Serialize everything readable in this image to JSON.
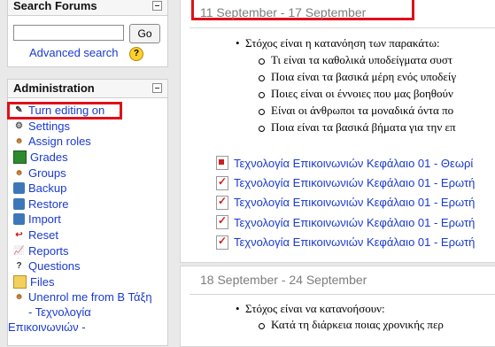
{
  "search_block": {
    "title": "Search Forums",
    "input_value": "",
    "go_label": "Go",
    "advanced_label": "Advanced search",
    "help_glyph": "?"
  },
  "admin_block": {
    "title": "Administration",
    "items": [
      {
        "label": "Turn editing on",
        "icon": "edit-icon"
      },
      {
        "label": "Settings",
        "icon": "settings-icon"
      },
      {
        "label": "Assign roles",
        "icon": "roles-icon"
      },
      {
        "label": "Grades",
        "icon": "grades-icon"
      },
      {
        "label": "Groups",
        "icon": "groups-icon"
      },
      {
        "label": "Backup",
        "icon": "backup-icon"
      },
      {
        "label": "Restore",
        "icon": "restore-icon"
      },
      {
        "label": "Import",
        "icon": "import-icon"
      },
      {
        "label": "Reset",
        "icon": "reset-icon"
      },
      {
        "label": "Reports",
        "icon": "reports-icon"
      },
      {
        "label": "Questions",
        "icon": "questions-icon"
      },
      {
        "label": "Files",
        "icon": "folder-icon"
      }
    ],
    "unenrol_lines": [
      "Unenrol me from Β Τάξη",
      "- Τεχνολογία",
      "Επικοινωνιών -"
    ]
  },
  "week1": {
    "title": "11 September - 17 September",
    "goal": "Στόχος είναι η κατανόηση των παρακάτω:",
    "points": [
      "Τι είναι τα καθολικά υποδείγματα συστ",
      "Ποια είναι τα βασικά μέρη ενός υποδείγ",
      "Ποιες είναι οι έννοιες που μας βοηθούν",
      "Είναι οι άνθρωποι τα μοναδικά όντα πο",
      "Ποια είναι τα βασικά βήματα για την επ"
    ],
    "resources": [
      {
        "label": "Τεχνολογία Επικοινωνιών Κεφάλαιο 01 - Θεωρί",
        "icon": "pdf-icon"
      },
      {
        "label": "Τεχνολογία Επικοινωνιών Κεφάλαιο 01 - Ερωτή",
        "icon": "quiz-icon"
      },
      {
        "label": "Τεχνολογία Επικοινωνιών Κεφάλαιο 01 - Ερωτή",
        "icon": "quiz-icon"
      },
      {
        "label": "Τεχνολογία Επικοινωνιών Κεφάλαιο 01 - Ερωτή",
        "icon": "quiz-icon"
      },
      {
        "label": "Τεχνολογία Επικοινωνιών Κεφάλαιο 01 - Ερωτή",
        "icon": "quiz-icon"
      }
    ]
  },
  "week2": {
    "title": "18 September - 24 September",
    "goal": "Στόχος είναι να κατανοήσουν:",
    "points": [
      "Κατά τη διάρκεια ποιας χρονικής περ"
    ]
  },
  "colors": {
    "link": "#1a3ad0",
    "highlight": "#e0101a",
    "week_title": "#7d7d7d"
  }
}
